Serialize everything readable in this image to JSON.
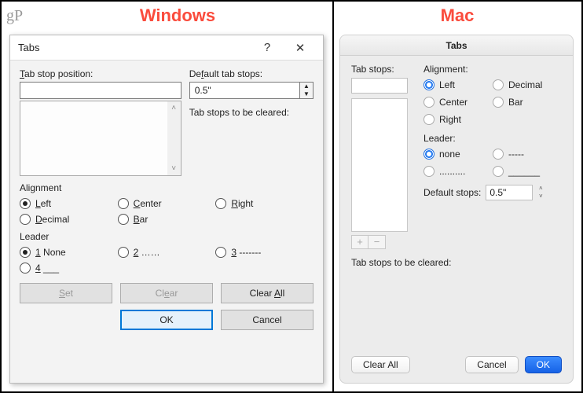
{
  "header": {
    "logo": "gP",
    "windows": "Windows",
    "mac": "Mac"
  },
  "windows": {
    "title": "Tabs",
    "help_glyph": "?",
    "close_glyph": "✕",
    "tab_stop_position_label_u": "T",
    "tab_stop_position_label_rest": "ab stop position:",
    "tab_stop_position_value": "",
    "default_label_rest": "ault tab stops:",
    "default_value": "0.5\"",
    "to_be_cleared_label": "Tab stops to be cleared:",
    "alignment_label": "Alignment",
    "alignment": {
      "options": [
        "Left",
        "Center",
        "Right",
        "Decimal",
        "Bar"
      ],
      "selected": "Left"
    },
    "leader_label": "Leader",
    "leader": {
      "options": [
        "1 None",
        "2 ......",
        "3 -------",
        "4 ___"
      ],
      "selected": "1 None"
    },
    "buttons": {
      "set_rest": "et",
      "set": "Set",
      "clear": "Clear",
      "clear_all": "Clear All",
      "ok": "OK",
      "cancel": "Cancel"
    }
  },
  "mac": {
    "title": "Tabs",
    "tab_stops_label": "Tab stops:",
    "tab_stop_value": "",
    "plus_glyph": "+",
    "minus_glyph": "−",
    "alignment_label": "Alignment:",
    "alignment": [
      "Left",
      "Decimal",
      "Center",
      "Bar",
      "Right"
    ],
    "alignment_selected": "Left",
    "leader_label": "Leader:",
    "leader": [
      "none",
      "-----",
      "..........",
      "______"
    ],
    "leader_selected": "none",
    "default_label": "Default stops:",
    "default_value": "0.5\"",
    "to_be_cleared_label": "Tab stops to be cleared:",
    "buttons": {
      "clear_all": "Clear All",
      "cancel": "Cancel",
      "ok": "OK"
    }
  }
}
